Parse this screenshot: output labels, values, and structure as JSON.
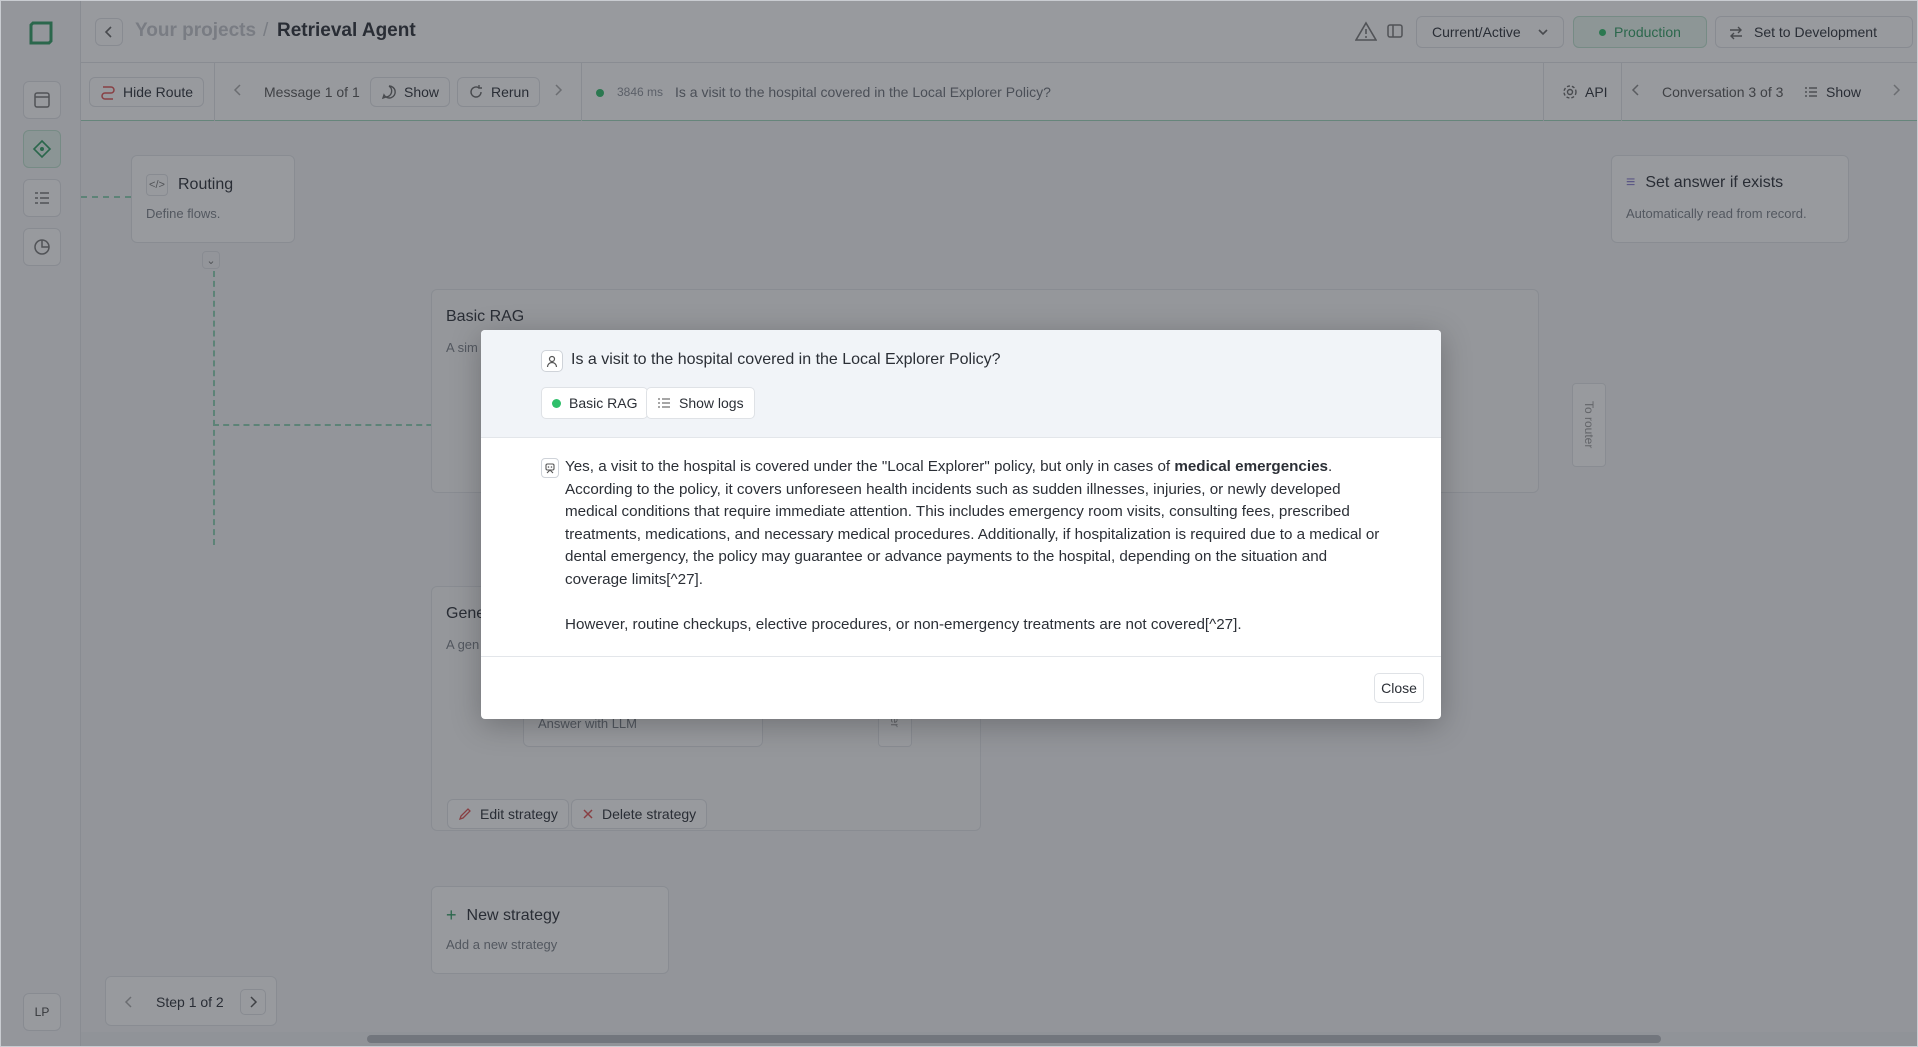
{
  "sidebar": {
    "logo": "app-logo",
    "items": [
      {
        "icon": "window-icon"
      },
      {
        "icon": "routing-diamond-icon",
        "active": true
      },
      {
        "icon": "table-list-icon"
      },
      {
        "icon": "pie-chart-icon"
      }
    ],
    "avatar_initials": "LP"
  },
  "header": {
    "breadcrumb_parent": "Your projects",
    "breadcrumb_sep": "/",
    "title": "Retrieval Agent",
    "version_select": "Current/Active",
    "status_badge": "Production",
    "set_dev_button": "Set to Development"
  },
  "toolbar": {
    "hide_route": "Hide Route",
    "message_counter": "Message 1 of 1",
    "show": "Show",
    "rerun": "Rerun",
    "latency": "3846 ms",
    "question": "Is a visit to the hospital covered in the Local Explorer Policy?",
    "api": "API",
    "conversation_counter": "Conversation 3 of 3",
    "show_right": "Show"
  },
  "canvas": {
    "routing": {
      "title": "Routing",
      "subtitle": "Define flows."
    },
    "set_answer": {
      "title": "Set answer if exists",
      "subtitle": "Automatically read from record."
    },
    "basic_rag": {
      "title": "Basic RAG",
      "subtitle": "A sim"
    },
    "generic": {
      "title": "Gene",
      "subtitle": "A gen"
    },
    "answer_llm": "Answer with LLM",
    "to_router": "To router",
    "to_router_partial": "outer",
    "edit_strategy": "Edit strategy",
    "delete_strategy": "Delete strategy",
    "new_strategy": {
      "title": "New strategy",
      "subtitle": "Add a new strategy"
    },
    "pager": "Step 1 of 2"
  },
  "modal": {
    "question": "Is a visit to the hospital covered in the Local Explorer Policy?",
    "chip_strategy": "Basic RAG",
    "chip_logs": "Show logs",
    "answer_p1_before": "Yes, a visit to the hospital is covered under the \"Local Explorer\" policy, but only in cases of ",
    "answer_p1_bold": "medical emergencies",
    "answer_p1_after": ". According to the policy, it covers unforeseen health incidents such as sudden illnesses, injuries, or newly developed medical conditions that require immediate attention. This includes emergency room visits, consulting fees, prescribed treatments, medications, and necessary medical procedures. Additionally, if hospitalization is required due to a medical or dental emergency, the policy may guarantee or advance payments to the hospital, depending on the situation and coverage limits[^27].",
    "answer_p2": "However, routine checkups, elective procedures, or non-emergency treatments are not covered[^27].",
    "close": "Close"
  },
  "colors": {
    "accent_green": "#2fbf6a",
    "overlay": "#282c34"
  }
}
